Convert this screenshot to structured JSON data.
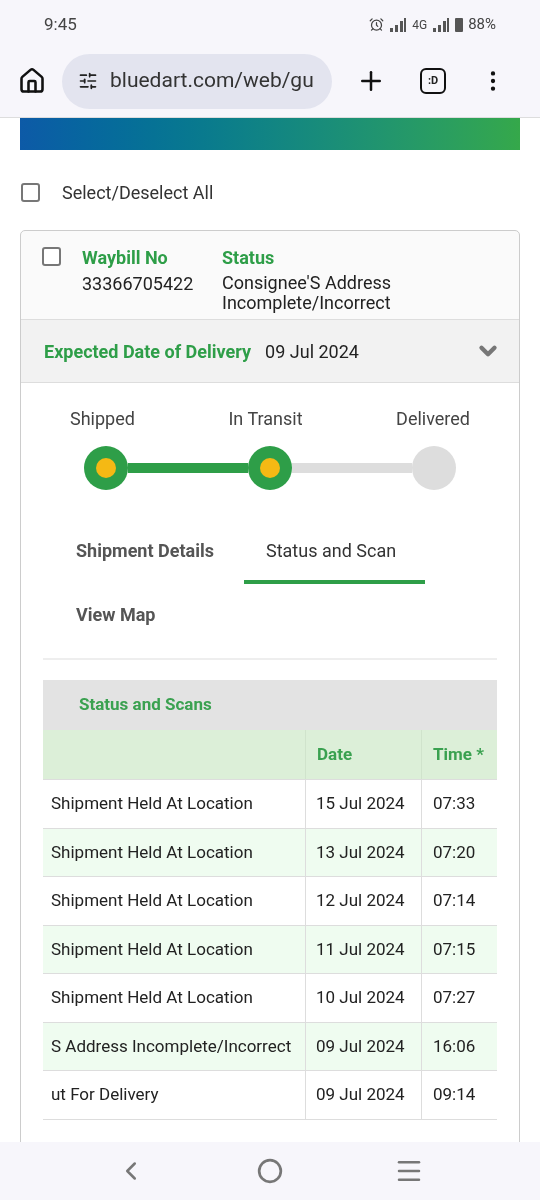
{
  "status_bar": {
    "time": "9:45",
    "network": "4G",
    "battery": "88%"
  },
  "browser": {
    "url": "bluedart.com/web/gu",
    "tab_count": ":D"
  },
  "select_all": {
    "label": "Select/Deselect All",
    "checked": false
  },
  "shipment": {
    "checked": false,
    "waybill_label": "Waybill No",
    "waybill": "33366705422",
    "status_label": "Status",
    "status": "Consignee'S Address Incomplete/Incorrect",
    "edd_label": "Expected Date of Delivery",
    "edd": "09 Jul 2024",
    "expanded": true
  },
  "progress": {
    "steps": [
      {
        "label": "Shipped",
        "done": true
      },
      {
        "label": "In Transit",
        "done": true
      },
      {
        "label": "Delivered",
        "done": false
      }
    ]
  },
  "tabs": [
    {
      "label": "Shipment Details",
      "selected": false
    },
    {
      "label": "Status and Scan",
      "selected": true
    },
    {
      "label": "View Map",
      "selected": false
    }
  ],
  "scans": {
    "title": "Status and Scans",
    "columns": [
      "Date",
      "Time *"
    ],
    "rows": [
      {
        "status": "Shipment Held At Location",
        "date": "15 Jul 2024",
        "time": "07:33"
      },
      {
        "status": "Shipment Held At Location",
        "date": "13 Jul 2024",
        "time": "07:20"
      },
      {
        "status": "Shipment Held At Location",
        "date": "12 Jul 2024",
        "time": "07:14"
      },
      {
        "status": "Shipment Held At Location",
        "date": "11 Jul 2024",
        "time": "07:15"
      },
      {
        "status": "Shipment Held At Location",
        "date": "10 Jul 2024",
        "time": "07:27"
      },
      {
        "status": "S Address Incomplete/Incorrect",
        "date": "09 Jul 2024",
        "time": "16:06"
      },
      {
        "status": "ut For Delivery",
        "date": "09 Jul 2024",
        "time": "09:14"
      }
    ]
  }
}
